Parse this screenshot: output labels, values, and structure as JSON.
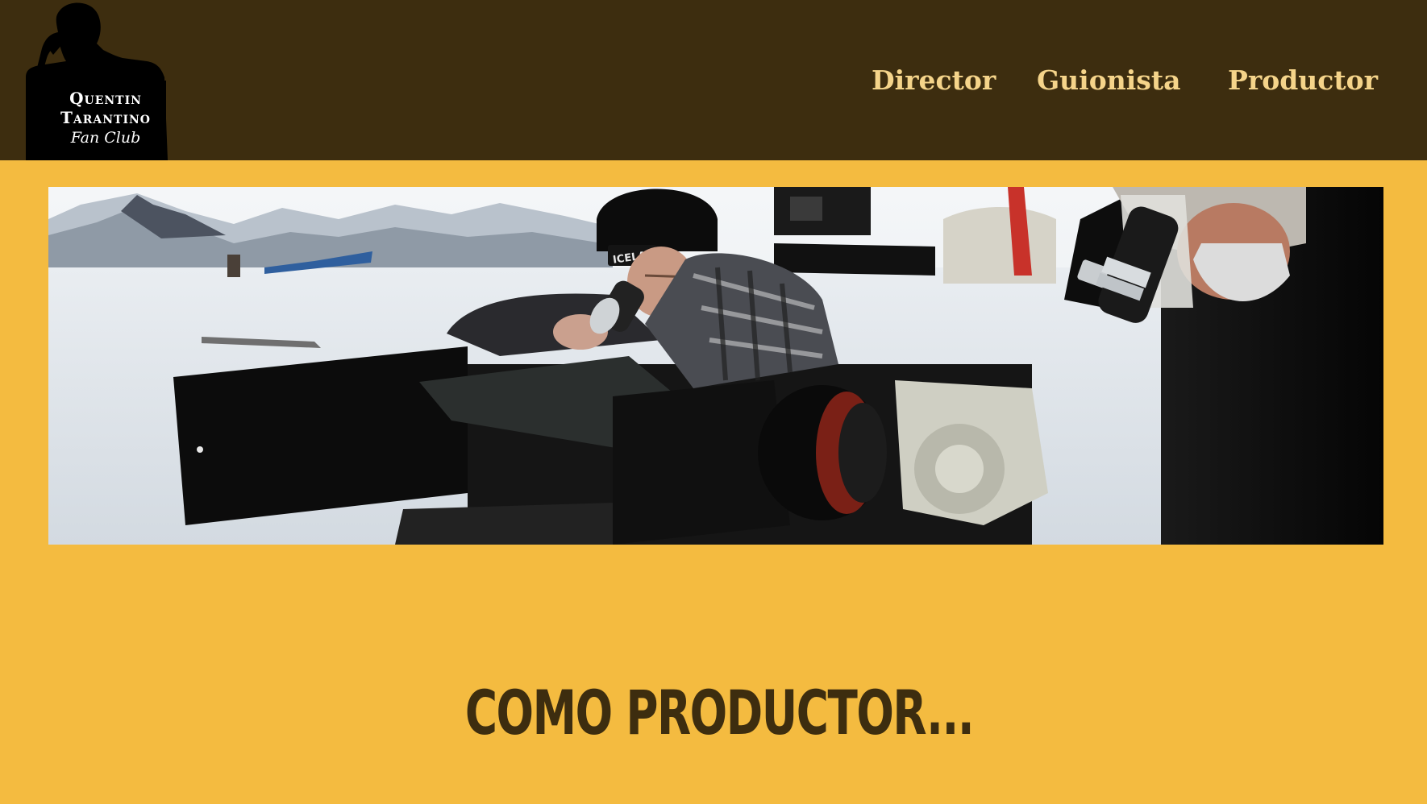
{
  "brand": {
    "line1": "Quentin",
    "line2": "Tarantino",
    "line3": "Fan Club"
  },
  "nav": {
    "items": [
      {
        "label": "Director"
      },
      {
        "label": "Guionista"
      },
      {
        "label": "Productor"
      }
    ]
  },
  "hero": {
    "icon": "hero-photo",
    "badge_text": "ICELAND"
  },
  "section": {
    "title": "COMO PRODUCTOR..."
  },
  "colors": {
    "header_bg": "#3d2d0f",
    "page_bg": "#f4bb40",
    "nav_text": "#f5d48a",
    "title_text": "#3d2d0f"
  }
}
